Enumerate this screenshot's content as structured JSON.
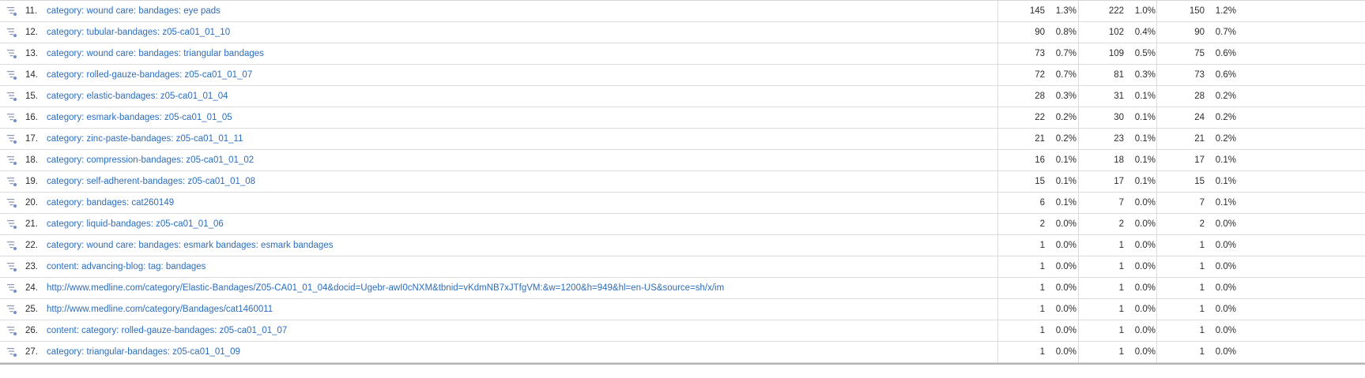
{
  "rows": [
    {
      "n": "11.",
      "label": "category: wound care: bandages: eye pads",
      "c1": "145",
      "p1": "1.3%",
      "c2": "222",
      "p2": "1.0%",
      "c3": "150",
      "p3": "1.2%"
    },
    {
      "n": "12.",
      "label": "category: tubular-bandages: z05-ca01_01_10",
      "c1": "90",
      "p1": "0.8%",
      "c2": "102",
      "p2": "0.4%",
      "c3": "90",
      "p3": "0.7%"
    },
    {
      "n": "13.",
      "label": "category: wound care: bandages: triangular bandages",
      "c1": "73",
      "p1": "0.7%",
      "c2": "109",
      "p2": "0.5%",
      "c3": "75",
      "p3": "0.6%"
    },
    {
      "n": "14.",
      "label": "category: rolled-gauze-bandages: z05-ca01_01_07",
      "c1": "72",
      "p1": "0.7%",
      "c2": "81",
      "p2": "0.3%",
      "c3": "73",
      "p3": "0.6%"
    },
    {
      "n": "15.",
      "label": "category: elastic-bandages: z05-ca01_01_04",
      "c1": "28",
      "p1": "0.3%",
      "c2": "31",
      "p2": "0.1%",
      "c3": "28",
      "p3": "0.2%"
    },
    {
      "n": "16.",
      "label": "category: esmark-bandages: z05-ca01_01_05",
      "c1": "22",
      "p1": "0.2%",
      "c2": "30",
      "p2": "0.1%",
      "c3": "24",
      "p3": "0.2%"
    },
    {
      "n": "17.",
      "label": "category: zinc-paste-bandages: z05-ca01_01_11",
      "c1": "21",
      "p1": "0.2%",
      "c2": "23",
      "p2": "0.1%",
      "c3": "21",
      "p3": "0.2%"
    },
    {
      "n": "18.",
      "label": "category: compression-bandages: z05-ca01_01_02",
      "c1": "16",
      "p1": "0.1%",
      "c2": "18",
      "p2": "0.1%",
      "c3": "17",
      "p3": "0.1%"
    },
    {
      "n": "19.",
      "label": "category: self-adherent-bandages: z05-ca01_01_08",
      "c1": "15",
      "p1": "0.1%",
      "c2": "17",
      "p2": "0.1%",
      "c3": "15",
      "p3": "0.1%"
    },
    {
      "n": "20.",
      "label": "category: bandages: cat260149",
      "c1": "6",
      "p1": "0.1%",
      "c2": "7",
      "p2": "0.0%",
      "c3": "7",
      "p3": "0.1%"
    },
    {
      "n": "21.",
      "label": "category: liquid-bandages: z05-ca01_01_06",
      "c1": "2",
      "p1": "0.0%",
      "c2": "2",
      "p2": "0.0%",
      "c3": "2",
      "p3": "0.0%"
    },
    {
      "n": "22.",
      "label": "category: wound care: bandages: esmark bandages: esmark bandages",
      "c1": "1",
      "p1": "0.0%",
      "c2": "1",
      "p2": "0.0%",
      "c3": "1",
      "p3": "0.0%"
    },
    {
      "n": "23.",
      "label": "content: advancing-blog: tag: bandages",
      "c1": "1",
      "p1": "0.0%",
      "c2": "1",
      "p2": "0.0%",
      "c3": "1",
      "p3": "0.0%"
    },
    {
      "n": "24.",
      "label": "http://www.medline.com/category/Elastic-Bandages/Z05-CA01_01_04&docid=Ugebr-awI0cNXM&tbnid=vKdmNB7xJTfgVM:&w=1200&h=949&hl=en-US&source=sh/x/im",
      "c1": "1",
      "p1": "0.0%",
      "c2": "1",
      "p2": "0.0%",
      "c3": "1",
      "p3": "0.0%"
    },
    {
      "n": "25.",
      "label": "http://www.medline.com/category/Bandages/cat1460011",
      "c1": "1",
      "p1": "0.0%",
      "c2": "1",
      "p2": "0.0%",
      "c3": "1",
      "p3": "0.0%"
    },
    {
      "n": "26.",
      "label": "content: category: rolled-gauze-bandages: z05-ca01_01_07",
      "c1": "1",
      "p1": "0.0%",
      "c2": "1",
      "p2": "0.0%",
      "c3": "1",
      "p3": "0.0%"
    },
    {
      "n": "27.",
      "label": "category: triangular-bandages: z05-ca01_01_09",
      "c1": "1",
      "p1": "0.0%",
      "c2": "1",
      "p2": "0.0%",
      "c3": "1",
      "p3": "0.0%"
    }
  ],
  "colors": {
    "link": "#2c6dbd",
    "icon": "#8a96b3",
    "grid": "#dcdcdc"
  },
  "icons": {
    "row_action": "breakdown-icon"
  }
}
